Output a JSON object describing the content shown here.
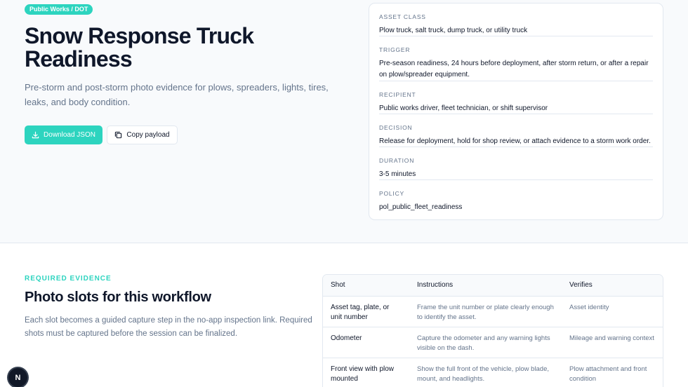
{
  "hero": {
    "badge": "Public Works / DOT",
    "title": "Snow Response Truck Readiness",
    "description": "Pre-storm and post-storm photo evidence for plows, spreaders, lights, tires, leaks, and body condition.",
    "download_label": "Download JSON",
    "copy_label": "Copy payload"
  },
  "meta": {
    "asset_class": {
      "label": "ASSET CLASS",
      "value": "Plow truck, salt truck, dump truck, or utility truck"
    },
    "trigger": {
      "label": "TRIGGER",
      "value": "Pre-season readiness, 24 hours before deployment, after storm return, or after a repair on plow/spreader equipment."
    },
    "recipient": {
      "label": "RECIPIENT",
      "value": "Public works driver, fleet technician, or shift supervisor"
    },
    "decision": {
      "label": "DECISION",
      "value": "Release for deployment, hold for shop review, or attach evidence to a storm work order."
    },
    "duration": {
      "label": "DURATION",
      "value": "3-5 minutes"
    },
    "policy": {
      "label": "POLICY",
      "value": "pol_public_fleet_readiness"
    }
  },
  "evidence": {
    "eyebrow": "REQUIRED EVIDENCE",
    "title": "Photo slots for this workflow",
    "description": "Each slot becomes a guided capture step in the no-app inspection link. Required shots must be captured before the session can be finalized.",
    "columns": {
      "shot": "Shot",
      "instructions": "Instructions",
      "verifies": "Verifies"
    },
    "rows": [
      {
        "shot": "Asset tag, plate, or unit number",
        "instructions": "Frame the unit number or plate clearly enough to identify the asset.",
        "verifies": "Asset identity"
      },
      {
        "shot": "Odometer",
        "instructions": "Capture the odometer and any warning lights visible on the dash.",
        "verifies": "Mileage and warning context"
      },
      {
        "shot": "Front view with plow mounted",
        "instructions": "Show the full front of the vehicle, plow blade, mount, and headlights.",
        "verifies": "Plow attachment and front condition"
      }
    ]
  },
  "fab": {
    "label": "N"
  }
}
